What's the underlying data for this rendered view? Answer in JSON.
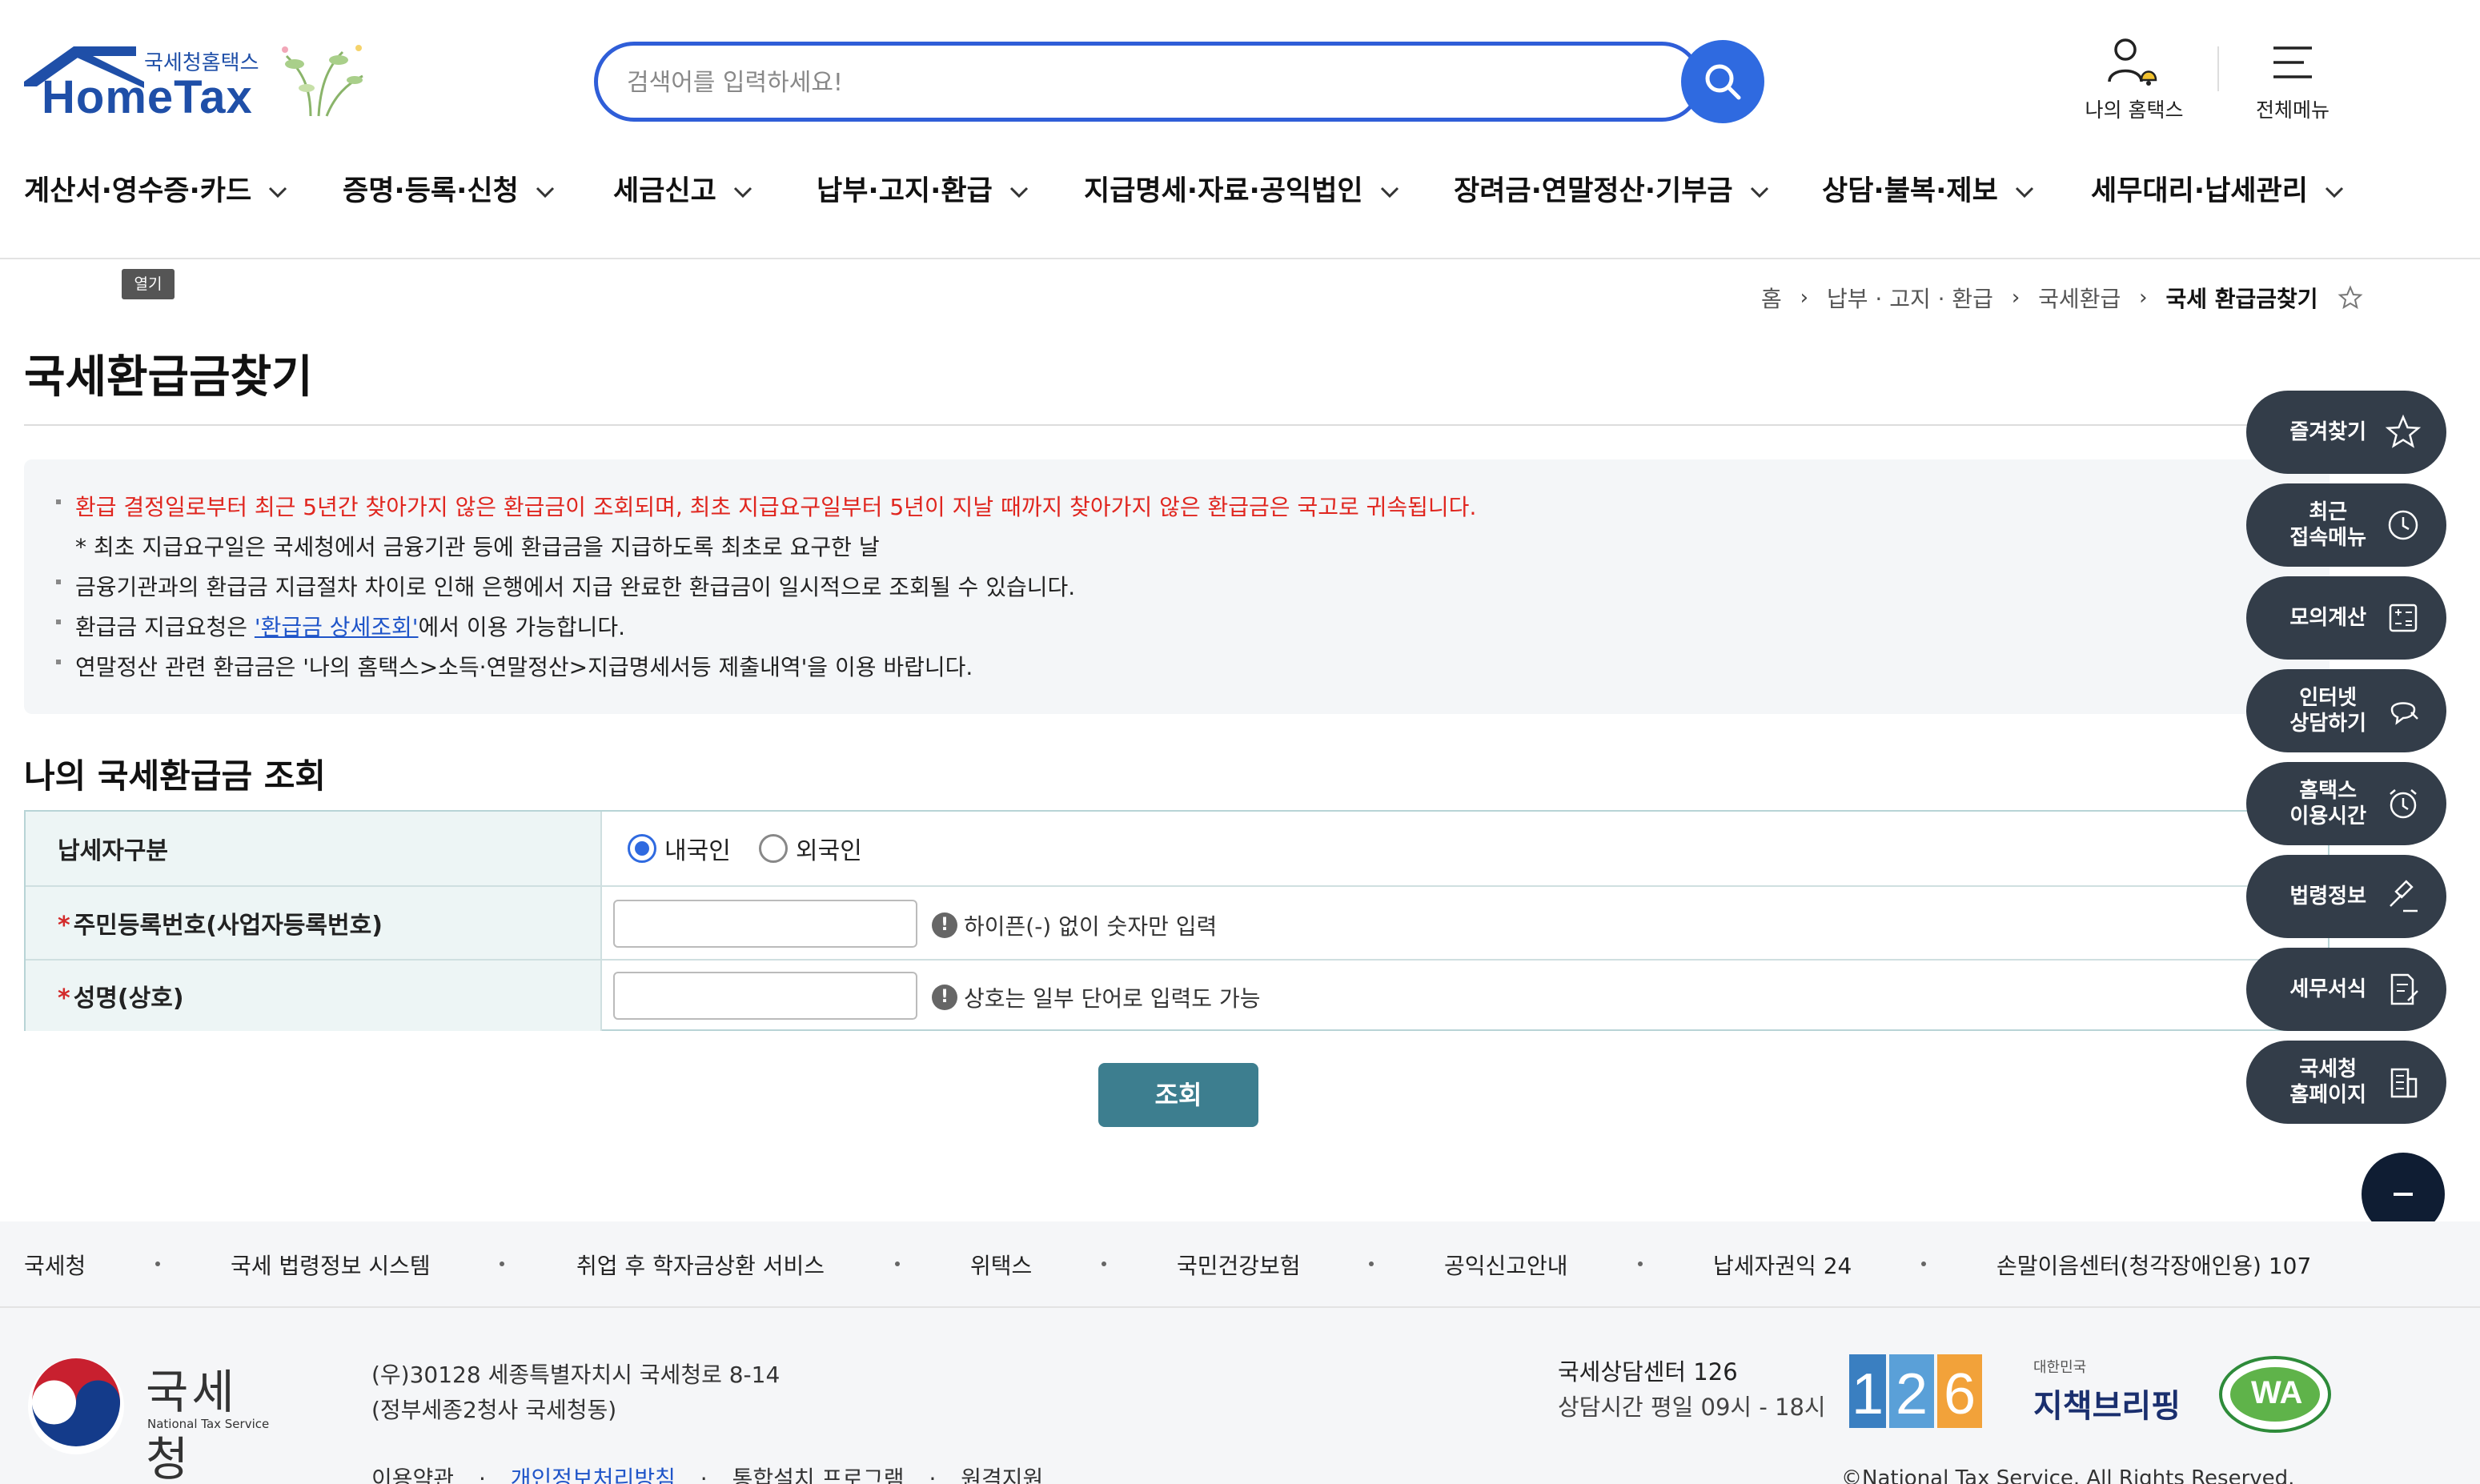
{
  "header": {
    "logo_sub": "국세청홈택스",
    "logo_main": "HomeTax",
    "search_placeholder": "검색어를 입력하세요!",
    "my_hometax": "나의 홈택스",
    "all_menu": "전체메뉴"
  },
  "gnb": [
    {
      "label": "계산서·영수증·카드"
    },
    {
      "label": "증명·등록·신청"
    },
    {
      "label": "세금신고"
    },
    {
      "label": "납부·고지·환급"
    },
    {
      "label": "지급명세·자료·공익법인"
    },
    {
      "label": "장려금·연말정산·기부금"
    },
    {
      "label": "상담·불복·제보"
    },
    {
      "label": "세무대리·납세관리"
    }
  ],
  "tooltip": "열기",
  "breadcrumb": {
    "home": "홈",
    "level1": "납부 · 고지 · 환급",
    "level2": "국세환급",
    "current": "국세 환급금찾기"
  },
  "page_title": "국세환급금찾기",
  "notice": {
    "line1": "환급 결정일로부터 최근 5년간 찾아가지 않은 환급금이 조회되며, 최초 지급요구일부터 5년이 지날 때까지 찾아가지 않은 환급금은 국고로 귀속됩니다.",
    "line2": "* 최초 지급요구일은 국세청에서 금융기관 등에 환급금을 지급하도록 최초로 요구한 날",
    "line3": "금융기관과의 환급금 지급절차 차이로 인해 은행에서 지급 완료한 환급금이 일시적으로 조회될 수 있습니다.",
    "line4_pre": "환급금 지급요청은 ",
    "line4_link": "'환급금 상세조회'",
    "line4_post": "에서 이용 가능합니다.",
    "line5": "연말정산 관련 환급금은 '나의 홈택스>소득·연말정산>지급명세서등 제출내역'을 이용 바랍니다."
  },
  "section_title": "나의 국세환급금 조회",
  "form": {
    "taxpayer_type_label": "납세자구분",
    "radio_domestic": "내국인",
    "radio_foreign": "외국인",
    "selected": "내국인",
    "id_label": "주민등록번호(사업자등록번호)",
    "id_value": "",
    "id_hint": "하이픈(-) 없이 숫자만 입력",
    "name_label": "성명(상호)",
    "name_value": "",
    "name_hint": "상호는 일부 단어로 입력도 가능",
    "required_mark": "*",
    "hint_mark": "!",
    "submit": "조회"
  },
  "quick_menu": [
    {
      "label": "즐겨찾기",
      "icon": "star-icon"
    },
    {
      "label": "최근\n접속메뉴",
      "icon": "clock-icon"
    },
    {
      "label": "모의계산",
      "icon": "calculator-icon"
    },
    {
      "label": "인터넷\n상담하기",
      "icon": "chat-icon"
    },
    {
      "label": "홈택스\n이용시간",
      "icon": "alarm-icon"
    },
    {
      "label": "법령정보",
      "icon": "gavel-icon"
    },
    {
      "label": "세무서식",
      "icon": "document-edit-icon"
    },
    {
      "label": "국세청\n홈페이지",
      "icon": "building-icon"
    }
  ],
  "footer": {
    "links": [
      "국세청",
      "국세 법령정보 시스템",
      "취업 후 학자금상환 서비스",
      "위택스",
      "국민건강보험",
      "공익신고안내",
      "납세자권익 24",
      "손말이음센터(청각장애인용) 107"
    ],
    "logo_kr": "국세청",
    "logo_en": "National Tax Service",
    "address1": "(우)30128 세종특별자치시 국세청로 8-14",
    "address2": "(정부세종2청사 국세청동)",
    "center_title": "국세상담센터 126",
    "center_hours": "상담시간 평일 09시 - 18시",
    "badge_126": "126",
    "policy_brief": "지책브리핑",
    "policy_brief_sub": "대한민국",
    "wa_mark": "WA",
    "bottom_links": [
      "이용약관",
      "개인정보처리방침",
      "통합설치 프로그램",
      "원격지원"
    ],
    "copyright": "©National Tax Service. All Rights Reserved."
  }
}
